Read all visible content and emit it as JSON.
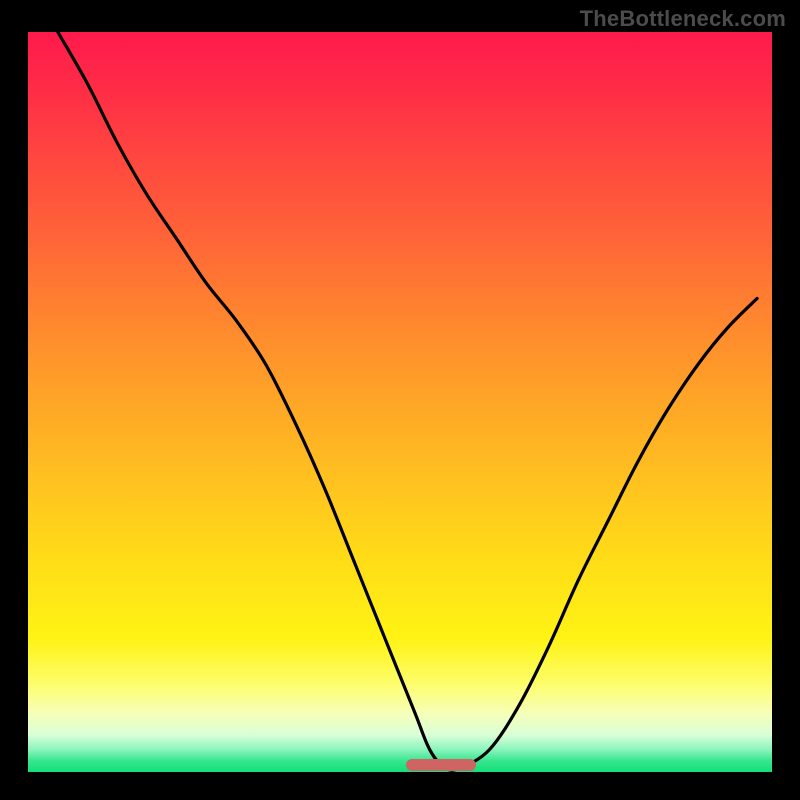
{
  "attribution": "TheBottleneck.com",
  "colors": {
    "black": "#000000",
    "curve": "#000000",
    "marker": "#ce6563",
    "attribution_text": "#4c4c4c"
  },
  "chart_data": {
    "type": "line",
    "title": "",
    "xlabel": "",
    "ylabel": "",
    "xlim": [
      0,
      100
    ],
    "ylim": [
      0,
      100
    ],
    "series": [
      {
        "name": "bottleneck-curve",
        "x": [
          4,
          8,
          12,
          16,
          20,
          24,
          28,
          32,
          36,
          40,
          44,
          48,
          52,
          54,
          56,
          58,
          62,
          66,
          70,
          74,
          78,
          82,
          86,
          90,
          94,
          98
        ],
        "y": [
          100,
          93,
          85,
          78,
          72,
          66,
          61,
          55,
          47,
          38,
          28,
          18,
          8,
          3,
          0.6,
          0.5,
          3,
          9,
          17,
          26,
          34,
          42,
          49,
          55,
          60,
          64
        ]
      }
    ],
    "marker": {
      "x_center": 55.5,
      "width_pct": 9.5,
      "height_pct": 1.6
    },
    "annotations": []
  }
}
